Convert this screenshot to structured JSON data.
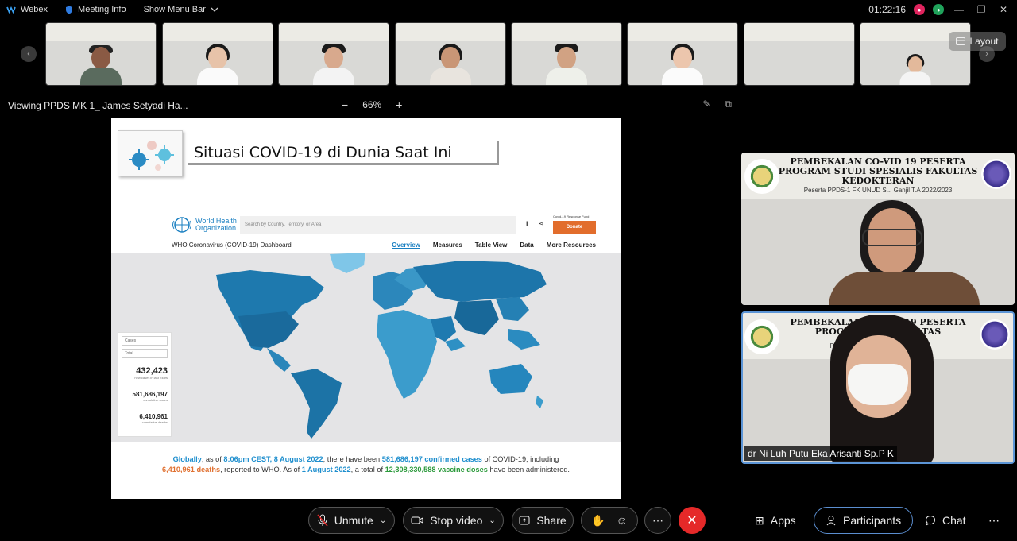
{
  "topbar": {
    "app_name": "Webex",
    "meeting_info": "Meeting Info",
    "show_menu_bar": "Show Menu Bar",
    "timer": "01:22:16"
  },
  "layout_button": "Layout",
  "viewbar": {
    "title": "Viewing PPDS MK 1_ James Setyadi Ha...",
    "zoom": "66%",
    "zoom_out": "−",
    "zoom_in": "+"
  },
  "slide": {
    "title": "Situasi COVID-19 di Dunia Saat Ini",
    "who": {
      "org_line1": "World Health",
      "org_line2": "Organization",
      "search_placeholder": "Search by Country, Territory, or Area",
      "donate": "Donate",
      "fund": "Covid-19 Response Fund",
      "dashboard_title": "WHO Coronavirus (COVID-19) Dashboard",
      "nav": [
        "Overview",
        "Measures",
        "Table View",
        "Data",
        "More Resources"
      ]
    },
    "stats": {
      "select1": "Cases",
      "select2": "Total",
      "new_cases": "432,423",
      "new_cases_label": "new cases in last 24hrs",
      "confirmed": "581,686,197",
      "confirmed_label": "cumulative cases",
      "deaths": "6,410,961",
      "deaths_label": "cumulative deaths"
    },
    "caption": {
      "globally": "Globally",
      "t1": ", as of ",
      "time": "8:06pm CEST, 8 August 2022",
      "t2": ", there have been ",
      "cases": "581,686,197 confirmed cases",
      "t3": " of COVID-19, including",
      "deaths": "6,410,961 deaths",
      "t4": ", reported to WHO. As of ",
      "date2": "1 August 2022",
      "t5": ", a total of ",
      "vaccines": "12,308,330,588 vaccine doses",
      "t6": " have been administered."
    }
  },
  "videos": {
    "banner_line1": "PEMBEKALAN CO-VID 19 PESERTA",
    "banner_line2": "PROGRAM STUDI SPESIALIS FAKULTAS",
    "banner_line3": "KEDOKTERAN",
    "banner_sub": "Peserta PPDS-1 FK UNUD S... Ganjil T.A 2022/2023",
    "v2_line1": "PEMBEKALAN CO-VID 19 PESERTA",
    "v2_line2": "PROGRAM S... FAKULTAS",
    "v2_sub": "Peserta PPDS-1 ... T.A 2022/2023",
    "speaker_name": "dr Ni Luh Putu Eka Arisanti Sp.P K"
  },
  "controls": {
    "unmute": "Unmute",
    "stop_video": "Stop video",
    "share": "Share",
    "apps": "Apps",
    "participants": "Participants",
    "chat": "Chat"
  },
  "colors": {
    "accent_blue": "#1f8fce",
    "end_red": "#e52929",
    "record_red": "#e0245e",
    "active_border": "#5c95d6"
  }
}
